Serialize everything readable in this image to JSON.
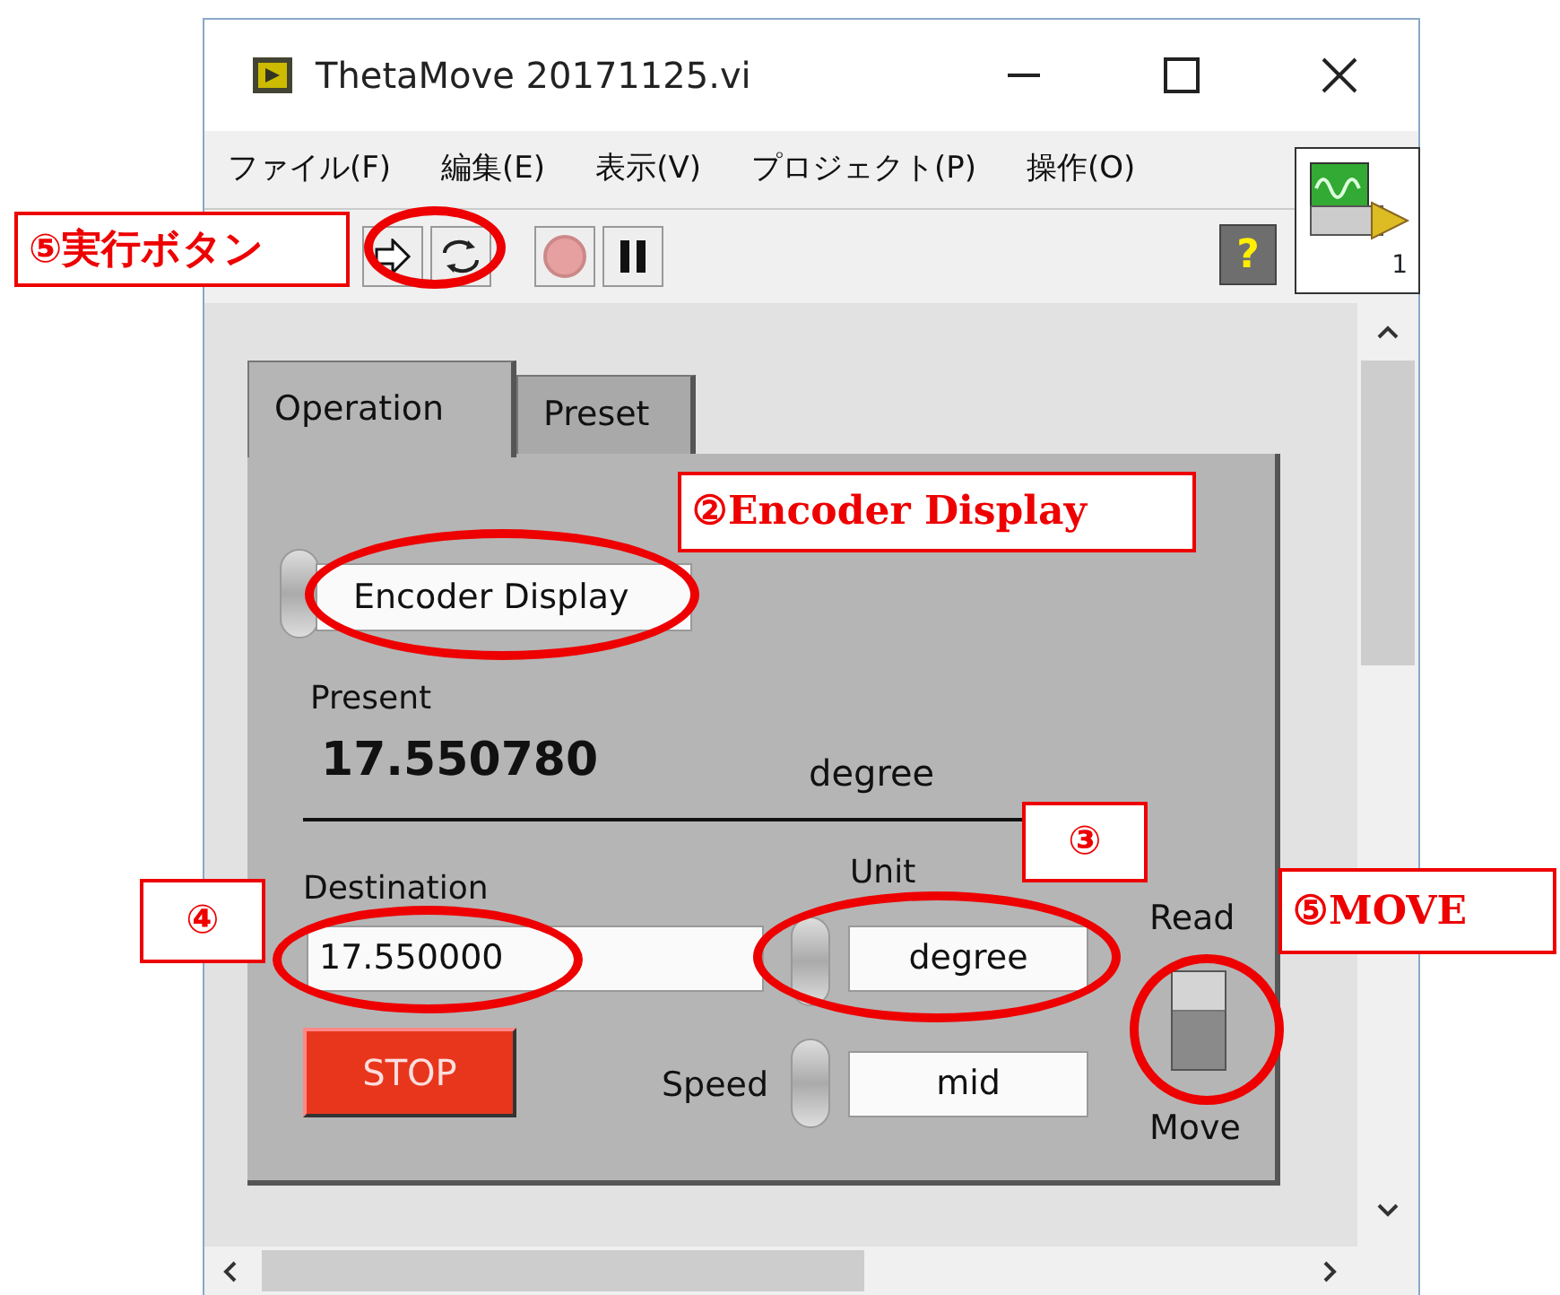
{
  "window": {
    "title": "ThetaMove 20171125.vi"
  },
  "menu": [
    "ファイル(F)",
    "編集(E)",
    "表示(V)",
    "プロジェクト(P)",
    "操作(O)"
  ],
  "toolbar": {
    "help": "?",
    "connector_pane": "1"
  },
  "tabs": [
    {
      "label": "Operation",
      "selected": true
    },
    {
      "label": "Preset",
      "selected": false
    }
  ],
  "panel": {
    "ring": "Encoder Display",
    "present_label": "Present",
    "present_value": "17.550780",
    "present_unit": "degree",
    "destination_label": "Destination",
    "destination_value": "17.550000",
    "unit_label": "Unit",
    "unit_value": "degree",
    "stop_button": "STOP",
    "speed_label": "Speed",
    "speed_value": "mid",
    "switch": {
      "top_label": "Read",
      "bottom_label": "Move",
      "on": true
    }
  },
  "annotations": [
    "⑤実行ボタン",
    "②Encoder Display",
    "③",
    "④",
    "⑤MOVE"
  ]
}
